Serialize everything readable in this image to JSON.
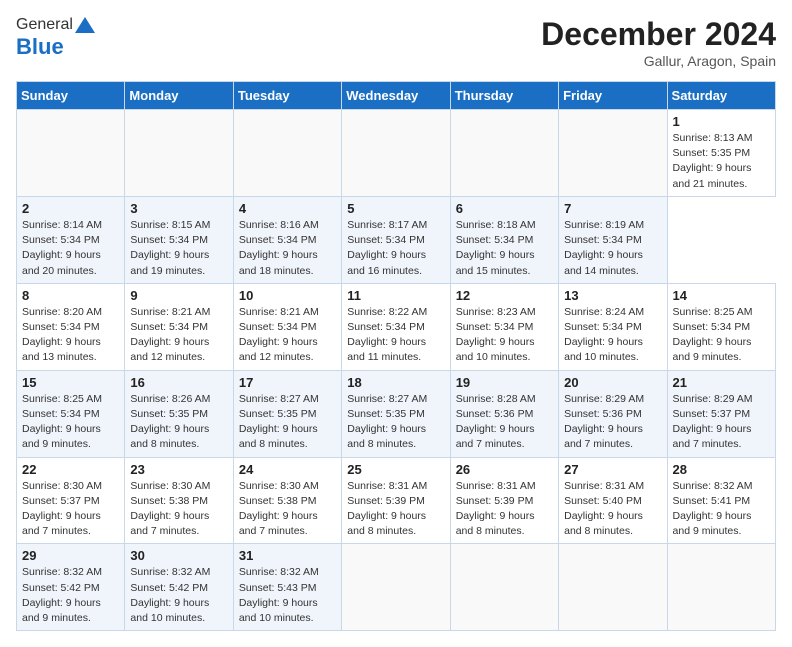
{
  "header": {
    "logo_general": "General",
    "logo_blue": "Blue",
    "title": "December 2024",
    "subtitle": "Gallur, Aragon, Spain"
  },
  "calendar": {
    "days_of_week": [
      "Sunday",
      "Monday",
      "Tuesday",
      "Wednesday",
      "Thursday",
      "Friday",
      "Saturday"
    ],
    "weeks": [
      [
        null,
        null,
        null,
        null,
        null,
        null,
        {
          "day": 1,
          "sunrise": "Sunrise: 8:13 AM",
          "sunset": "Sunset: 5:35 PM",
          "daylight": "Daylight: 9 hours and 21 minutes."
        }
      ],
      [
        {
          "day": 2,
          "sunrise": "Sunrise: 8:14 AM",
          "sunset": "Sunset: 5:34 PM",
          "daylight": "Daylight: 9 hours and 20 minutes."
        },
        {
          "day": 3,
          "sunrise": "Sunrise: 8:15 AM",
          "sunset": "Sunset: 5:34 PM",
          "daylight": "Daylight: 9 hours and 19 minutes."
        },
        {
          "day": 4,
          "sunrise": "Sunrise: 8:16 AM",
          "sunset": "Sunset: 5:34 PM",
          "daylight": "Daylight: 9 hours and 18 minutes."
        },
        {
          "day": 5,
          "sunrise": "Sunrise: 8:17 AM",
          "sunset": "Sunset: 5:34 PM",
          "daylight": "Daylight: 9 hours and 16 minutes."
        },
        {
          "day": 6,
          "sunrise": "Sunrise: 8:18 AM",
          "sunset": "Sunset: 5:34 PM",
          "daylight": "Daylight: 9 hours and 15 minutes."
        },
        {
          "day": 7,
          "sunrise": "Sunrise: 8:19 AM",
          "sunset": "Sunset: 5:34 PM",
          "daylight": "Daylight: 9 hours and 14 minutes."
        }
      ],
      [
        {
          "day": 8,
          "sunrise": "Sunrise: 8:20 AM",
          "sunset": "Sunset: 5:34 PM",
          "daylight": "Daylight: 9 hours and 13 minutes."
        },
        {
          "day": 9,
          "sunrise": "Sunrise: 8:21 AM",
          "sunset": "Sunset: 5:34 PM",
          "daylight": "Daylight: 9 hours and 12 minutes."
        },
        {
          "day": 10,
          "sunrise": "Sunrise: 8:21 AM",
          "sunset": "Sunset: 5:34 PM",
          "daylight": "Daylight: 9 hours and 12 minutes."
        },
        {
          "day": 11,
          "sunrise": "Sunrise: 8:22 AM",
          "sunset": "Sunset: 5:34 PM",
          "daylight": "Daylight: 9 hours and 11 minutes."
        },
        {
          "day": 12,
          "sunrise": "Sunrise: 8:23 AM",
          "sunset": "Sunset: 5:34 PM",
          "daylight": "Daylight: 9 hours and 10 minutes."
        },
        {
          "day": 13,
          "sunrise": "Sunrise: 8:24 AM",
          "sunset": "Sunset: 5:34 PM",
          "daylight": "Daylight: 9 hours and 10 minutes."
        },
        {
          "day": 14,
          "sunrise": "Sunrise: 8:25 AM",
          "sunset": "Sunset: 5:34 PM",
          "daylight": "Daylight: 9 hours and 9 minutes."
        }
      ],
      [
        {
          "day": 15,
          "sunrise": "Sunrise: 8:25 AM",
          "sunset": "Sunset: 5:34 PM",
          "daylight": "Daylight: 9 hours and 9 minutes."
        },
        {
          "day": 16,
          "sunrise": "Sunrise: 8:26 AM",
          "sunset": "Sunset: 5:35 PM",
          "daylight": "Daylight: 9 hours and 8 minutes."
        },
        {
          "day": 17,
          "sunrise": "Sunrise: 8:27 AM",
          "sunset": "Sunset: 5:35 PM",
          "daylight": "Daylight: 9 hours and 8 minutes."
        },
        {
          "day": 18,
          "sunrise": "Sunrise: 8:27 AM",
          "sunset": "Sunset: 5:35 PM",
          "daylight": "Daylight: 9 hours and 8 minutes."
        },
        {
          "day": 19,
          "sunrise": "Sunrise: 8:28 AM",
          "sunset": "Sunset: 5:36 PM",
          "daylight": "Daylight: 9 hours and 7 minutes."
        },
        {
          "day": 20,
          "sunrise": "Sunrise: 8:29 AM",
          "sunset": "Sunset: 5:36 PM",
          "daylight": "Daylight: 9 hours and 7 minutes."
        },
        {
          "day": 21,
          "sunrise": "Sunrise: 8:29 AM",
          "sunset": "Sunset: 5:37 PM",
          "daylight": "Daylight: 9 hours and 7 minutes."
        }
      ],
      [
        {
          "day": 22,
          "sunrise": "Sunrise: 8:30 AM",
          "sunset": "Sunset: 5:37 PM",
          "daylight": "Daylight: 9 hours and 7 minutes."
        },
        {
          "day": 23,
          "sunrise": "Sunrise: 8:30 AM",
          "sunset": "Sunset: 5:38 PM",
          "daylight": "Daylight: 9 hours and 7 minutes."
        },
        {
          "day": 24,
          "sunrise": "Sunrise: 8:30 AM",
          "sunset": "Sunset: 5:38 PM",
          "daylight": "Daylight: 9 hours and 7 minutes."
        },
        {
          "day": 25,
          "sunrise": "Sunrise: 8:31 AM",
          "sunset": "Sunset: 5:39 PM",
          "daylight": "Daylight: 9 hours and 8 minutes."
        },
        {
          "day": 26,
          "sunrise": "Sunrise: 8:31 AM",
          "sunset": "Sunset: 5:39 PM",
          "daylight": "Daylight: 9 hours and 8 minutes."
        },
        {
          "day": 27,
          "sunrise": "Sunrise: 8:31 AM",
          "sunset": "Sunset: 5:40 PM",
          "daylight": "Daylight: 9 hours and 8 minutes."
        },
        {
          "day": 28,
          "sunrise": "Sunrise: 8:32 AM",
          "sunset": "Sunset: 5:41 PM",
          "daylight": "Daylight: 9 hours and 9 minutes."
        }
      ],
      [
        {
          "day": 29,
          "sunrise": "Sunrise: 8:32 AM",
          "sunset": "Sunset: 5:42 PM",
          "daylight": "Daylight: 9 hours and 9 minutes."
        },
        {
          "day": 30,
          "sunrise": "Sunrise: 8:32 AM",
          "sunset": "Sunset: 5:42 PM",
          "daylight": "Daylight: 9 hours and 10 minutes."
        },
        {
          "day": 31,
          "sunrise": "Sunrise: 8:32 AM",
          "sunset": "Sunset: 5:43 PM",
          "daylight": "Daylight: 9 hours and 10 minutes."
        },
        null,
        null,
        null,
        null
      ]
    ]
  }
}
